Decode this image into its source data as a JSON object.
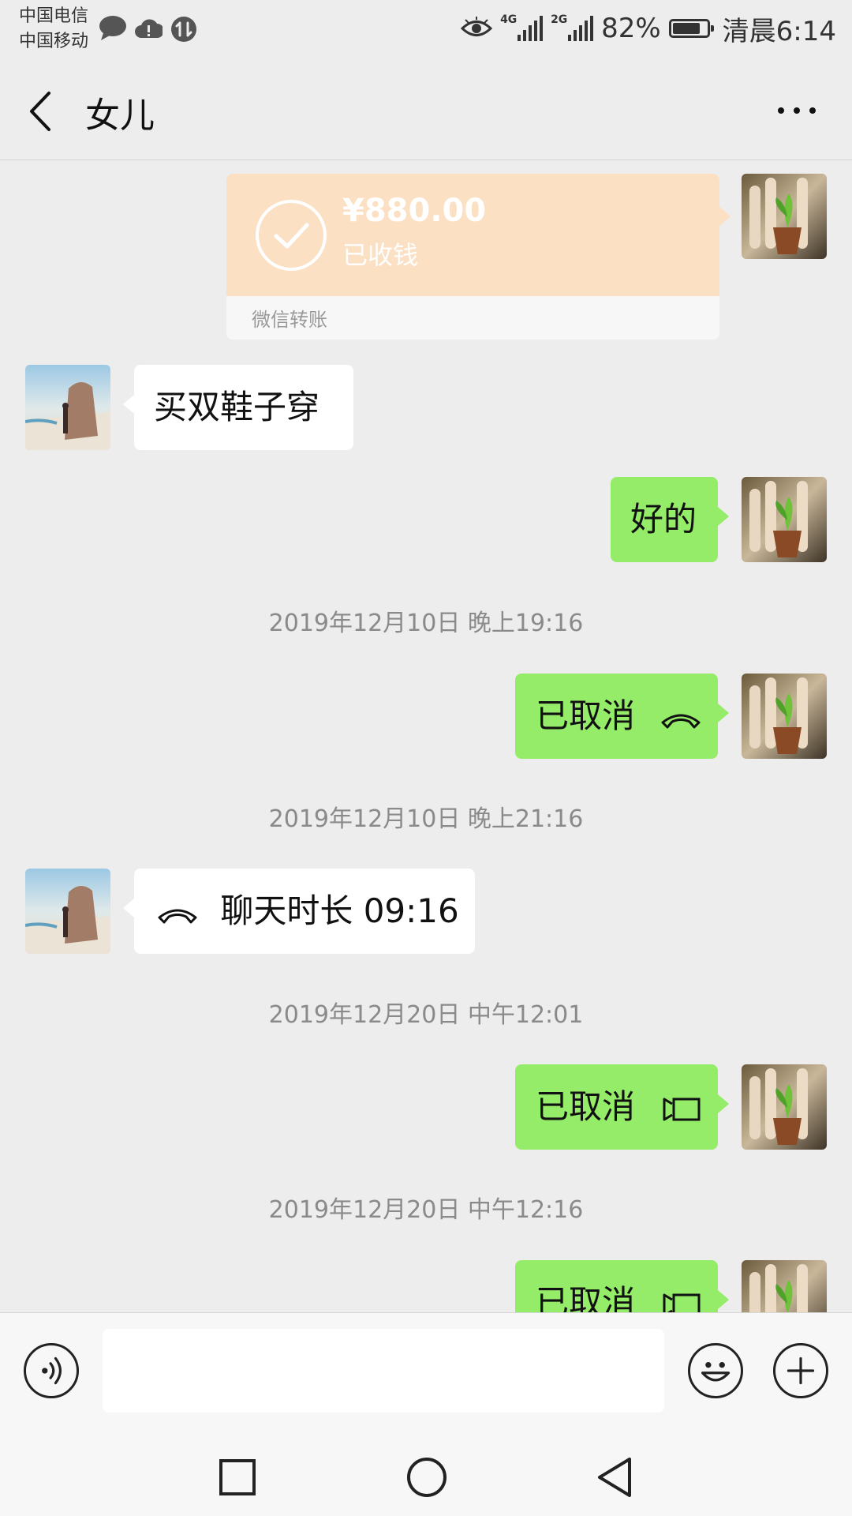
{
  "status_bar": {
    "carrier_1": "中国电信",
    "carrier_2": "中国移动",
    "network_1": "4G",
    "network_2": "2G",
    "battery_percent": "82%",
    "battery_level": 0.82,
    "time": "清晨6:14"
  },
  "header": {
    "title": "女儿"
  },
  "messages": {
    "transfer": {
      "amount": "¥880.00",
      "status": "已收钱",
      "footer": "微信转账"
    },
    "in_1": "买双鞋子穿",
    "out_1": "好的",
    "ts_1": "2019年12月10日 晚上19:16",
    "out_2": "已取消",
    "ts_2": "2019年12月10日 晚上21:16",
    "in_2": "聊天时长 09:16",
    "ts_3": "2019年12月20日 中午12:01",
    "out_3": "已取消",
    "ts_4": "2019年12月20日 中午12:16",
    "out_4": "已取消"
  },
  "input": {
    "placeholder": ""
  }
}
